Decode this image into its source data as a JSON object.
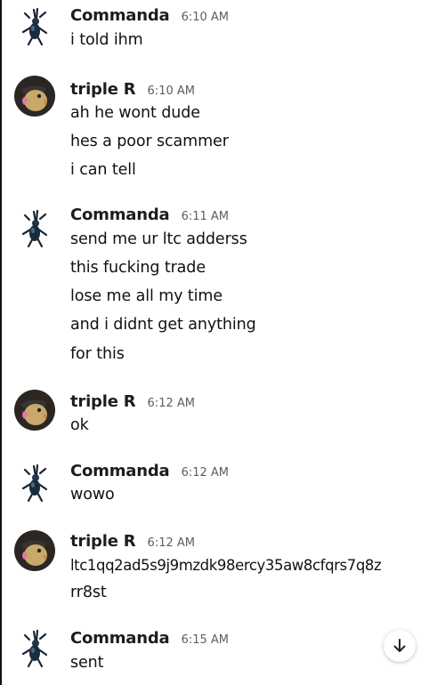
{
  "messages": [
    {
      "author": "Commanda",
      "time": "6:10 AM",
      "avatar_icon": "mantis-avatar-icon",
      "lines": [
        "i told ihm"
      ]
    },
    {
      "author": "triple R",
      "time": "6:10 AM",
      "avatar_icon": "bird-avatar-icon",
      "lines": [
        "ah he wont dude",
        "hes a poor scammer",
        "i can tell"
      ]
    },
    {
      "author": "Commanda",
      "time": "6:11 AM",
      "avatar_icon": "mantis-avatar-icon",
      "lines": [
        "send me ur ltc adderss",
        "this fucking trade",
        "lose me all my time",
        "and i didnt get anything",
        "for this"
      ]
    },
    {
      "author": "triple R",
      "time": "6:12 AM",
      "avatar_icon": "bird-avatar-icon",
      "lines": [
        "ok"
      ]
    },
    {
      "author": "Commanda",
      "time": "6:12 AM",
      "avatar_icon": "mantis-avatar-icon",
      "lines": [
        "wowo"
      ]
    },
    {
      "author": "triple R",
      "time": "6:12 AM",
      "avatar_icon": "bird-avatar-icon",
      "lines": [
        "ltc1qq2ad5s9j9mzdk98ercy35aw8cfqrs7q8z",
        "rr8st"
      ]
    },
    {
      "author": "Commanda",
      "time": "6:15 AM",
      "avatar_icon": "mantis-avatar-icon",
      "lines": [
        "sent"
      ]
    }
  ],
  "scroll_button": {
    "icon": "arrow-down-icon"
  }
}
